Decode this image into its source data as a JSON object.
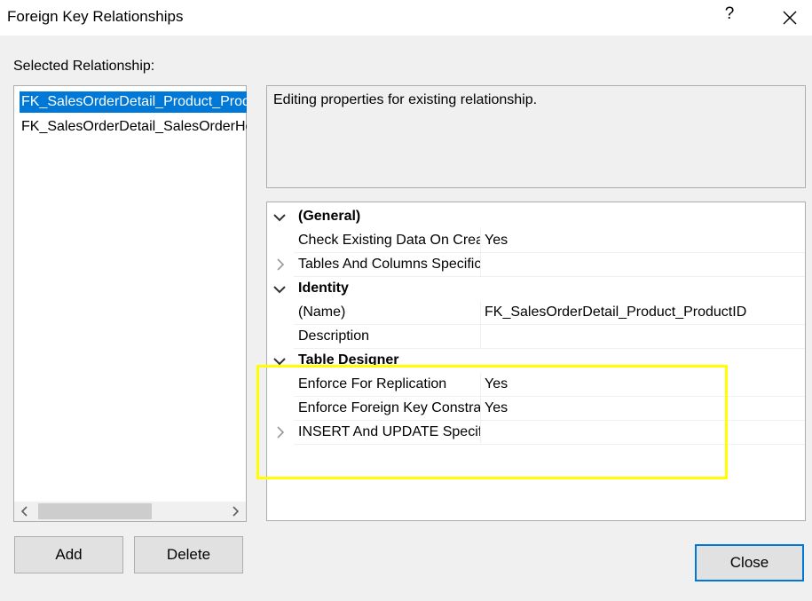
{
  "window": {
    "title": "Foreign Key Relationships",
    "help_label": "?"
  },
  "selected_relationship": {
    "label": "Selected Relationship:",
    "items": [
      "FK_SalesOrderDetail_Product_ProductID",
      "FK_SalesOrderDetail_SalesOrderHeader_SalesOrderID"
    ],
    "selected_index": 0,
    "scroll_left": "<",
    "scroll_right": ">"
  },
  "description": "Editing properties for existing relationship.",
  "properties": {
    "rows": [
      {
        "type": "category",
        "name": "(General)",
        "expanded": true
      },
      {
        "type": "prop",
        "name": "Check Existing Data On Creation Or Re-Enabling",
        "value": "Yes"
      },
      {
        "type": "prop",
        "name": "Tables And Columns Specification",
        "value": "",
        "expandable": true
      },
      {
        "type": "category",
        "name": "Identity",
        "expanded": true
      },
      {
        "type": "prop",
        "name": "(Name)",
        "value": "FK_SalesOrderDetail_Product_ProductID"
      },
      {
        "type": "prop",
        "name": "Description",
        "value": ""
      },
      {
        "type": "category",
        "name": "Table Designer",
        "expanded": true
      },
      {
        "type": "prop",
        "name": "Enforce For Replication",
        "value": "Yes"
      },
      {
        "type": "prop",
        "name": "Enforce Foreign Key Constraint",
        "value": "Yes"
      },
      {
        "type": "prop",
        "name": "INSERT And UPDATE Specification",
        "value": "",
        "expandable": true
      }
    ]
  },
  "buttons": {
    "add": "Add",
    "delete": "Delete",
    "close": "Close"
  },
  "colors": {
    "selection": "#0078d7",
    "highlight": "#ffff00",
    "dialog_bg": "#f0f0f0"
  }
}
